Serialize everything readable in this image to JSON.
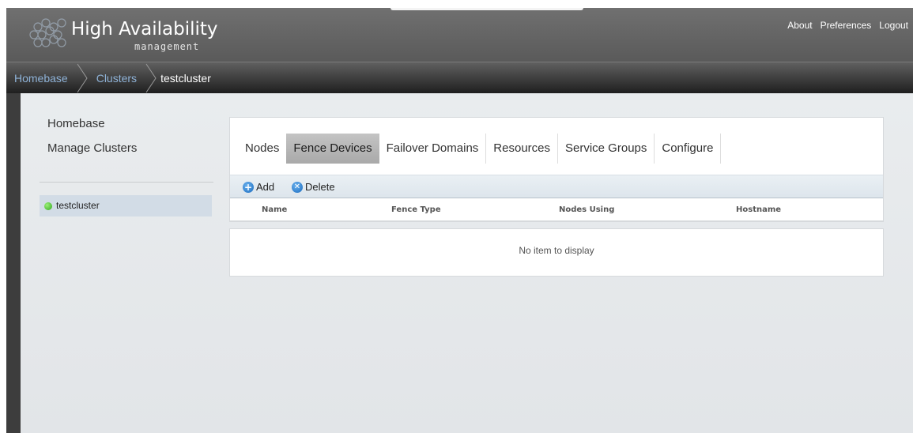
{
  "header": {
    "logo_title": "High Availability",
    "logo_subtitle": "management",
    "links": [
      "About",
      "Preferences",
      "Logout"
    ]
  },
  "breadcrumb": {
    "items": [
      "Homebase",
      "Clusters"
    ],
    "current": "testcluster"
  },
  "sidebar": {
    "links": [
      "Homebase",
      "Manage Clusters"
    ],
    "clusters": [
      {
        "name": "testcluster",
        "status": "online",
        "status_color": "#3cb521"
      }
    ]
  },
  "tabs": {
    "items": [
      "Nodes",
      "Fence Devices",
      "Failover Domains",
      "Resources",
      "Service Groups",
      "Configure"
    ],
    "active": "Fence Devices"
  },
  "toolbar": {
    "add_label": "Add",
    "delete_label": "Delete",
    "add_icon": "plus-circle-icon",
    "delete_icon": "x-circle-icon"
  },
  "table": {
    "columns": [
      "Name",
      "Fence Type",
      "Nodes Using",
      "Hostname"
    ],
    "rows": [],
    "empty_message": "No item to display"
  },
  "colors": {
    "breadcrumb_link": "#8fb3d8",
    "active_tab": "#b5b5b5",
    "selected_cluster": "#d2dce6"
  }
}
